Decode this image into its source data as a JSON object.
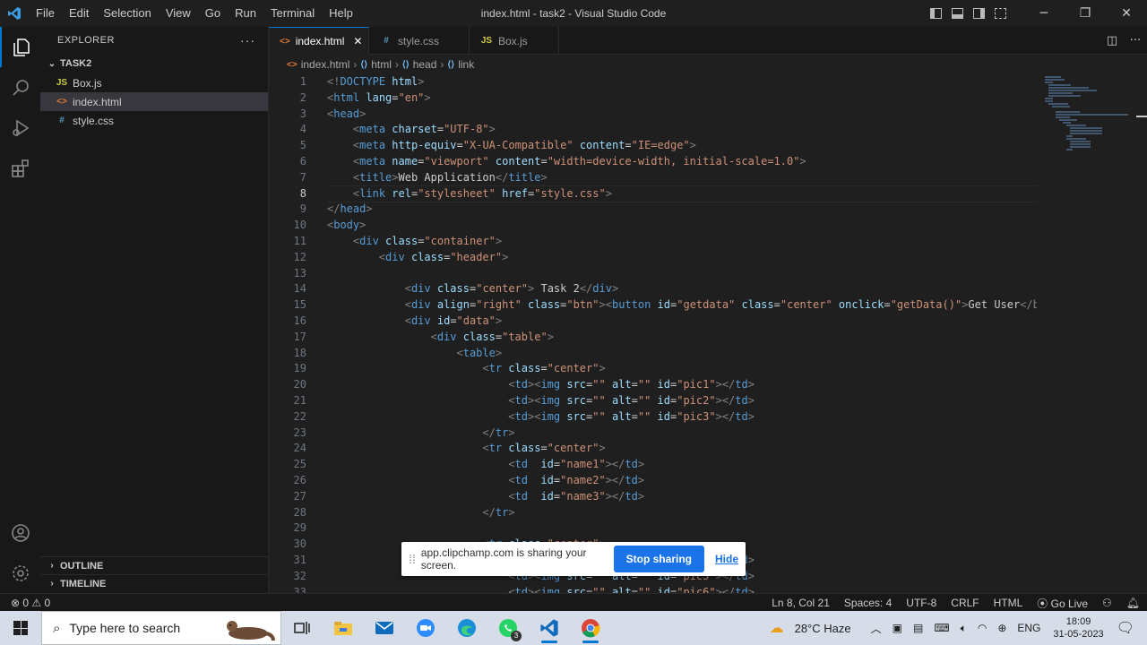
{
  "titlebar": {
    "menu": [
      "File",
      "Edit",
      "Selection",
      "View",
      "Go",
      "Run",
      "Terminal",
      "Help"
    ],
    "title": "index.html - task2 - Visual Studio Code"
  },
  "explorer": {
    "header": "EXPLORER",
    "folder": "TASK2",
    "files": [
      {
        "name": "Box.js",
        "icon": "JS"
      },
      {
        "name": "index.html",
        "icon": "<>"
      },
      {
        "name": "style.css",
        "icon": "#"
      }
    ],
    "outline": "OUTLINE",
    "timeline": "TIMELINE"
  },
  "tabs": [
    {
      "label": "index.html",
      "icon": "<>"
    },
    {
      "label": "style.css",
      "icon": "#"
    },
    {
      "label": "Box.js",
      "icon": "JS"
    }
  ],
  "breadcrumb": [
    "index.html",
    "html",
    "head",
    "link"
  ],
  "editor": {
    "line_numbers": [
      "1",
      "2",
      "3",
      "4",
      "5",
      "6",
      "7",
      "8",
      "9",
      "10",
      "11",
      "12",
      "13",
      "14",
      "15",
      "16",
      "17",
      "18",
      "19",
      "20",
      "21",
      "22",
      "23",
      "24",
      "25",
      "26",
      "27",
      "28",
      "29",
      "30",
      "31",
      "32",
      "33"
    ],
    "active_line": 8
  },
  "share": {
    "text": "app.clipchamp.com is sharing your screen.",
    "stop_label": "Stop sharing",
    "hide_label": "Hide"
  },
  "statusbar": {
    "problems": "⊗ 0 ⚠ 0",
    "position": "Ln 8, Col 21",
    "spaces": "Spaces: 4",
    "encoding": "UTF-8",
    "eol": "CRLF",
    "language": "HTML",
    "golive": "Go Live"
  },
  "taskbar": {
    "search_placeholder": "Type here to search",
    "weather": "28°C  Haze",
    "lang": "ENG",
    "time": "18:09",
    "date": "31-05-2023",
    "whatsapp_badge": "3"
  },
  "colors": {
    "tag": "#808080",
    "tagname": "#569cd6",
    "attr": "#9cdcfe",
    "string": "#ce9178",
    "text": "#cccccc",
    "accent": "#0078d4"
  }
}
